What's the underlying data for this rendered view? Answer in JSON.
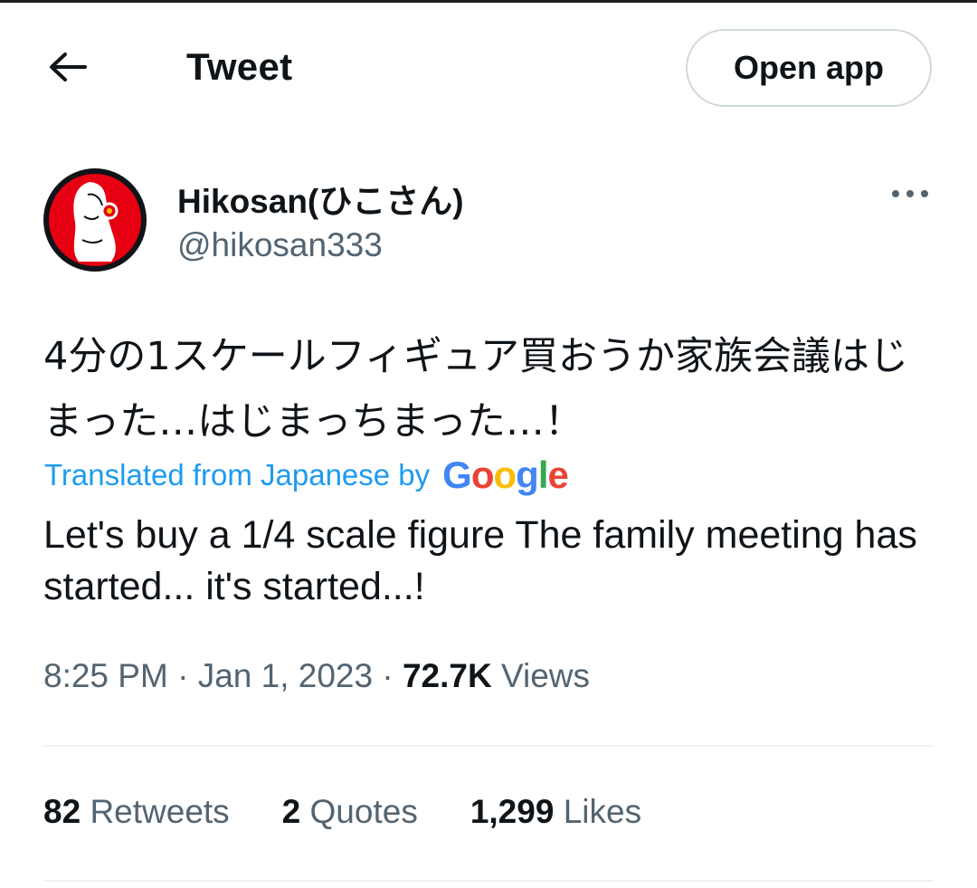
{
  "header": {
    "title": "Tweet",
    "open_app_label": "Open app"
  },
  "author": {
    "name": "Hikosan(ひこさん)",
    "handle": "@hikosan333"
  },
  "tweet": {
    "text_original": "4分の1スケールフィギュア買おうか家族会議はじまった…はじまっちまった…！",
    "translated_label": "Translated from Japanese by",
    "translation_provider": "Google",
    "text_translated": "Let's buy a 1/4 scale figure The family meeting has started... it's started...!"
  },
  "meta": {
    "time": "8:25 PM",
    "separator": "·",
    "date": "Jan 1, 2023",
    "views_count": "72.7K",
    "views_label": "Views"
  },
  "stats": {
    "retweets_count": "82",
    "retweets_label": "Retweets",
    "quotes_count": "2",
    "quotes_label": "Quotes",
    "likes_count": "1,299",
    "likes_label": "Likes"
  },
  "colors": {
    "link": "#1d9bf0",
    "secondary_text": "#536471",
    "primary_text": "#0f1419",
    "border": "#cfd9de",
    "avatar_red": "#e60012"
  },
  "icons": {
    "back": "arrow-left-icon",
    "more": "more-horizontal-icon"
  }
}
